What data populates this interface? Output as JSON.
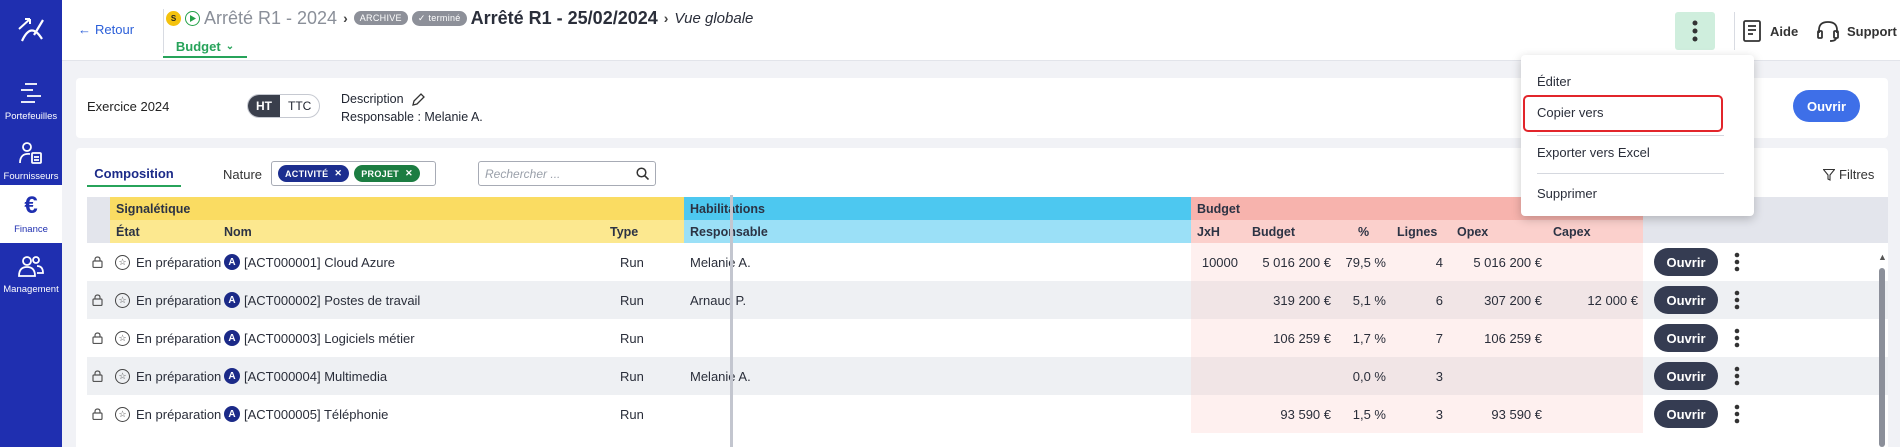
{
  "sidebar": {
    "items": [
      {
        "label": "Portefeuilles",
        "icon": "portfolio-icon"
      },
      {
        "label": "Fournisseurs",
        "icon": "supplier-icon"
      },
      {
        "label": "Finance",
        "icon": "euro-icon",
        "active": true
      },
      {
        "label": "Management",
        "icon": "people-icon"
      }
    ]
  },
  "header": {
    "back": "Retour",
    "status_s": "S",
    "crumb1": "Arrêté R1 - 2024",
    "badge_archive": "ARCHIVE",
    "badge_done": "✓ terminé",
    "crumb2": "Arrêté R1 - 25/02/2024",
    "crumb3": "Vue globale",
    "tab_budget": "Budget",
    "help": "Aide",
    "support": "Support"
  },
  "info": {
    "exercice": "Exercice 2024",
    "ht": "HT",
    "ttc": "TTC",
    "description": "Description",
    "responsable": "Responsable : Melanie A.",
    "open": "Ouvrir"
  },
  "toolbar": {
    "tab": "Composition",
    "nature_label": "Nature",
    "chips": [
      "ACTIVITÉ",
      "PROJET"
    ],
    "search_placeholder": "Rechercher ...",
    "filters": "Filtres"
  },
  "grid": {
    "groups": {
      "signaletique": "Signalétique",
      "habilitations": "Habilitations",
      "budget": "Budget"
    },
    "columns": {
      "etat": "État",
      "nom": "Nom",
      "type": "Type",
      "responsable": "Responsable",
      "jxh": "JxH",
      "budget": "Budget",
      "pct": "%",
      "lignes": "Lignes",
      "opex": "Opex",
      "capex": "Capex"
    },
    "rows": [
      {
        "etat": "En préparation",
        "letter": "A",
        "nom": "[ACT000001] Cloud Azure",
        "type": "Run",
        "responsable": "Melanie A.",
        "jxh": "10000",
        "budget": "5 016 200 €",
        "pct": "79,5 %",
        "lignes": "4",
        "opex": "5 016 200 €",
        "capex": "",
        "open": "Ouvrir"
      },
      {
        "etat": "En préparation",
        "letter": "A",
        "nom": "[ACT000002] Postes de travail",
        "type": "Run",
        "responsable": "Arnaud P.",
        "jxh": "",
        "budget": "319 200 €",
        "pct": "5,1 %",
        "lignes": "6",
        "opex": "307 200 €",
        "capex": "12 000 €",
        "open": "Ouvrir"
      },
      {
        "etat": "En préparation",
        "letter": "A",
        "nom": "[ACT000003] Logiciels métier",
        "type": "Run",
        "responsable": "",
        "jxh": "",
        "budget": "106 259 €",
        "pct": "1,7 %",
        "lignes": "7",
        "opex": "106 259 €",
        "capex": "",
        "open": "Ouvrir"
      },
      {
        "etat": "En préparation",
        "letter": "A",
        "nom": "[ACT000004] Multimedia",
        "type": "Run",
        "responsable": "Melanie A.",
        "jxh": "",
        "budget": "",
        "pct": "0,0 %",
        "lignes": "3",
        "opex": "",
        "capex": "",
        "open": "Ouvrir"
      },
      {
        "etat": "En préparation",
        "letter": "A",
        "nom": "[ACT000005] Téléphonie",
        "type": "Run",
        "responsable": "",
        "jxh": "",
        "budget": "93 590 €",
        "pct": "1,5 %",
        "lignes": "3",
        "opex": "93 590 €",
        "capex": "",
        "open": "Ouvrir"
      }
    ]
  },
  "menu": {
    "items": [
      "Éditer",
      "Copier vers",
      "Exporter vers Excel",
      "Supprimer"
    ]
  },
  "colors": {
    "sidebar": "#1f2fb0",
    "accent_green": "#27a35a",
    "primary_blue": "#3e6fe8",
    "highlight_red": "#e2252b"
  }
}
